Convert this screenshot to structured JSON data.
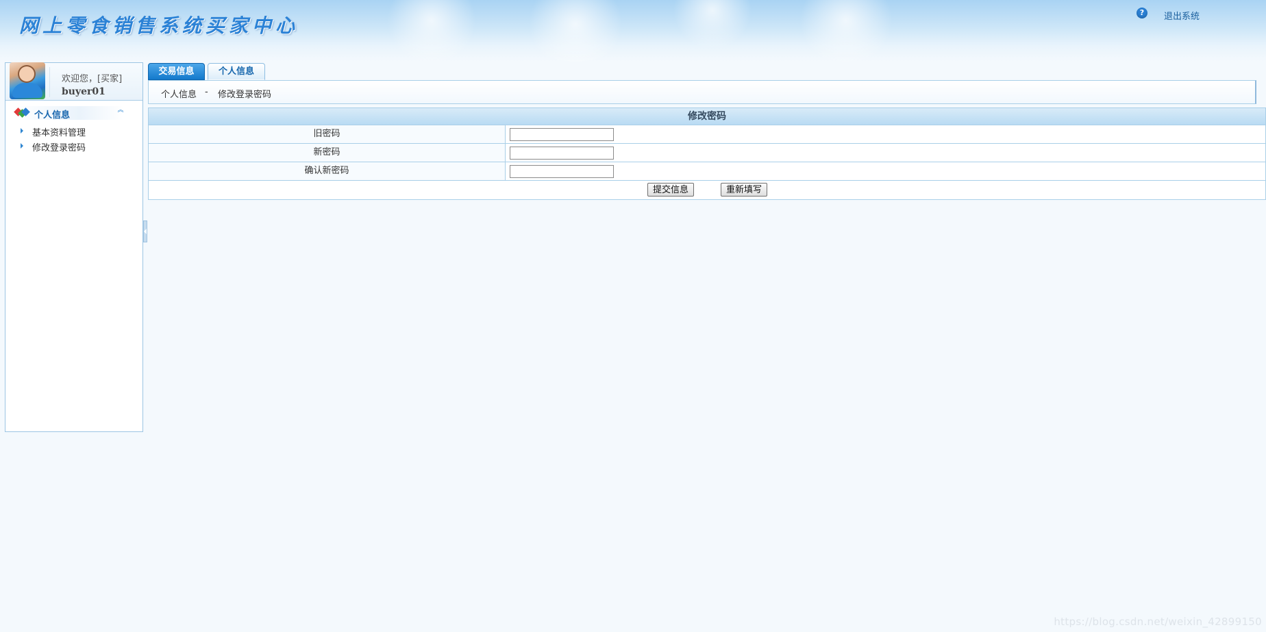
{
  "header": {
    "app_title": "网上零食销售系统买家中心",
    "help_icon_glyph": "?",
    "logout_label": "退出系统"
  },
  "user": {
    "welcome": "欢迎您，[买家]",
    "username": "buyer01"
  },
  "sidebar": {
    "section_label": "个人信息",
    "collapse_glyph": "︽",
    "items": [
      {
        "label": "基本资料管理"
      },
      {
        "label": "修改登录密码"
      }
    ]
  },
  "tabs": [
    {
      "label": "交易信息",
      "active": false
    },
    {
      "label": "个人信息",
      "active": true
    }
  ],
  "breadcrumb": {
    "parent": "个人信息",
    "separator": "-",
    "current": "修改登录密码"
  },
  "form": {
    "title": "修改密码",
    "fields": [
      {
        "label": "旧密码",
        "value": ""
      },
      {
        "label": "新密码",
        "value": ""
      },
      {
        "label": "确认新密码",
        "value": ""
      }
    ],
    "submit_label": "提交信息",
    "reset_label": "重新填写"
  },
  "watermark": "https://blog.csdn.net/weixin_42899150",
  "colors": {
    "accent": "#1379cc",
    "link": "#1a5f9e",
    "border": "#a9cfe8",
    "title_text": "#2b82d6"
  }
}
